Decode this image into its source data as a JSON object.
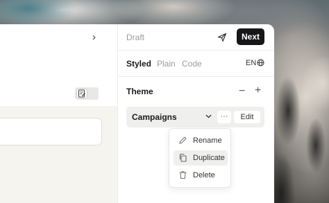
{
  "header": {
    "status": "Draft",
    "next_label": "Next"
  },
  "tabs": [
    {
      "label": "Styled",
      "active": true
    },
    {
      "label": "Plain",
      "active": false
    },
    {
      "label": "Code",
      "active": false
    }
  ],
  "language": "EN",
  "theme": {
    "label": "Theme",
    "selected": "Campaigns",
    "more_label": "···",
    "edit_label": "Edit"
  },
  "context_menu": {
    "items": [
      {
        "label": "Rename",
        "icon": "pencil-icon",
        "highlighted": false
      },
      {
        "label": "Duplicate",
        "icon": "copy-icon",
        "highlighted": true
      },
      {
        "label": "Delete",
        "icon": "trash-icon",
        "highlighted": false
      }
    ]
  },
  "colors": {
    "primary_button": "#17171a",
    "muted_text": "#9a9a98",
    "canvas_background": "#f6f4ee"
  }
}
